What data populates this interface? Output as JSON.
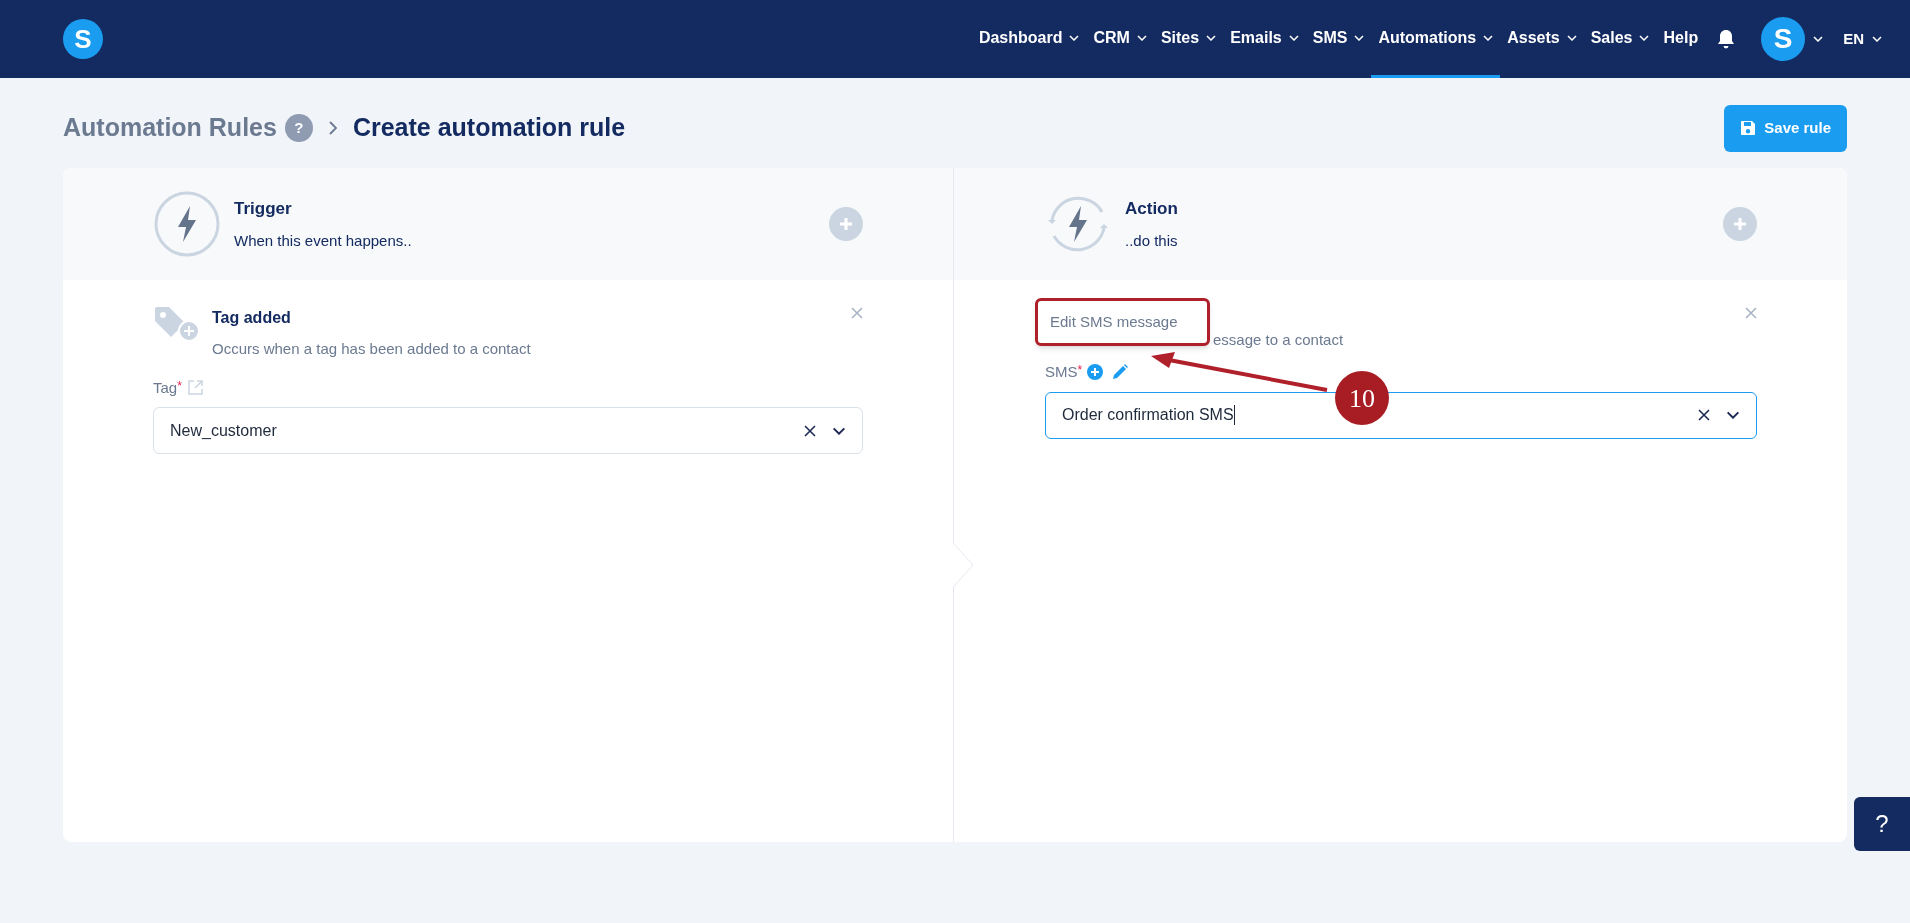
{
  "nav": {
    "logo_letter": "S",
    "items": [
      {
        "label": "Dashboard",
        "dropdown": true,
        "selected": false
      },
      {
        "label": "CRM",
        "dropdown": true,
        "selected": false
      },
      {
        "label": "Sites",
        "dropdown": true,
        "selected": false
      },
      {
        "label": "Emails",
        "dropdown": true,
        "selected": false
      },
      {
        "label": "SMS",
        "dropdown": true,
        "selected": false
      },
      {
        "label": "Automations",
        "dropdown": true,
        "selected": true
      },
      {
        "label": "Assets",
        "dropdown": true,
        "selected": false
      },
      {
        "label": "Sales",
        "dropdown": true,
        "selected": false
      },
      {
        "label": "Help",
        "dropdown": false,
        "selected": false
      }
    ],
    "avatar_letter": "S",
    "language": "EN"
  },
  "breadcrumb": {
    "parent": "Automation Rules",
    "help": "?",
    "current": "Create automation rule"
  },
  "save_button": "Save rule",
  "trigger": {
    "title": "Trigger",
    "subtitle": "When this event happens..",
    "item": {
      "title": "Tag added",
      "description": "Occurs when a tag has been added to a contact",
      "field": {
        "label": "Tag",
        "required_mark": "*",
        "value": "New_customer",
        "focused": false
      }
    }
  },
  "action": {
    "title": "Action",
    "subtitle": "..do this",
    "item": {
      "description": "essage to a contact",
      "field": {
        "label": "SMS",
        "required_mark": "*",
        "value": "Order confirmation SMS",
        "focused": true
      }
    },
    "tooltip": "Edit SMS message"
  },
  "annotation": {
    "badge": "10"
  },
  "help_button": "?"
}
